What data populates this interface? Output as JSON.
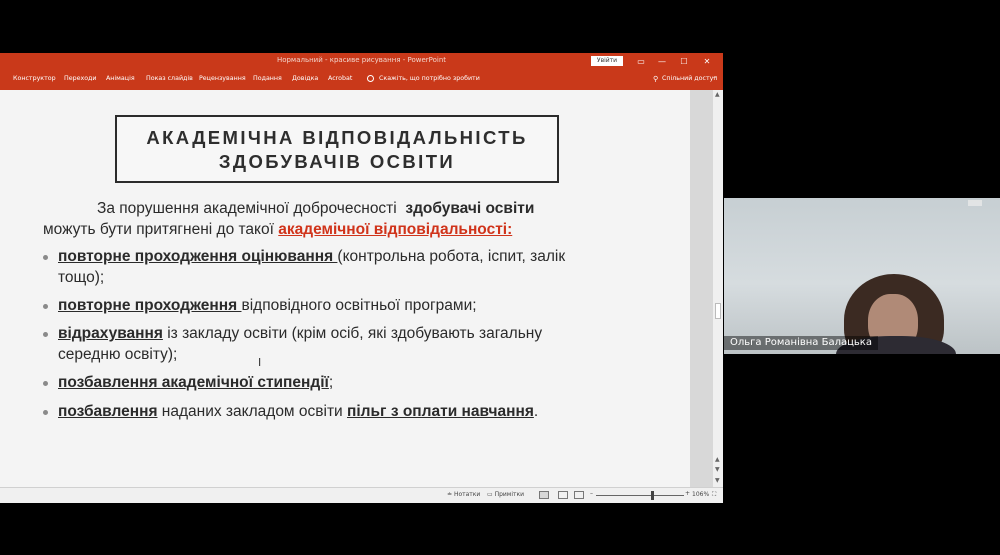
{
  "window": {
    "title": "Нормальний - красиве рисування - PowerPoint",
    "sign_in": "Увійти",
    "controls": [
      "—",
      "☐",
      "✕"
    ]
  },
  "ribbon": {
    "tabs": [
      "Конструктор",
      "Переходи",
      "Анімація",
      "Показ слайдів",
      "Рецензування",
      "Подання",
      "Довідка",
      "Acrobat"
    ],
    "tell_me": "Скажіть, що потрібно зробити",
    "share": "Спільний доступ"
  },
  "slide": {
    "title_line1": "АКАДЕМІЧНА ВІДПОВІДАЛЬНІСТЬ",
    "title_line2": "ЗДОБУВАЧІВ ОСВІТИ",
    "intro": {
      "part1": "За порушення академічної доброчесності",
      "part2": "здобувачі освіти",
      "part3": "можуть бути притягнені до такої",
      "part4": "академічної відповідальності:"
    },
    "bullets": [
      {
        "emph": "повторне проходження оцінювання ",
        "rest_line1": "(контрольна робота, іспит, залік",
        "rest_line2": "тощо);"
      },
      {
        "emph": "повторне проходження ",
        "rest_line1": "відповідного освітньої програми;"
      },
      {
        "emph": "відрахування",
        "rest_line1": " із закладу освіти (крім осіб, які здобувають загальну",
        "rest_line2": "середню освіту);"
      },
      {
        "emph": "позбавлення академічної стипендії",
        "rest_line1": ";"
      },
      {
        "emph": "позбавлення",
        "middle": " наданих закладом освіти ",
        "emph2": "пільг з оплати навчання",
        "rest_line1": "."
      }
    ]
  },
  "statusbar": {
    "notes": "Нотатки",
    "comments": "Примітки",
    "zoom": "106%"
  },
  "video": {
    "participant_name": "Ольга Романівна Балацька"
  }
}
